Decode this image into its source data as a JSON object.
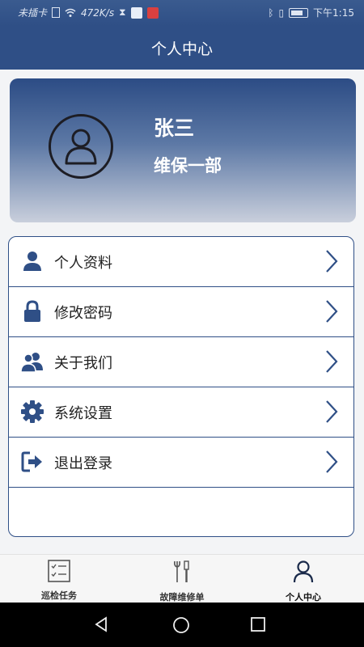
{
  "status_bar": {
    "carrier": "未插卡",
    "speed": "472K/s",
    "time": "下午1:15"
  },
  "header": {
    "title": "个人中心"
  },
  "profile": {
    "name": "张三",
    "department": "维保一部"
  },
  "menu": {
    "items": [
      {
        "label": "个人资料",
        "icon": "user-icon"
      },
      {
        "label": "修改密码",
        "icon": "lock-icon"
      },
      {
        "label": "关于我们",
        "icon": "users-icon"
      },
      {
        "label": "系统设置",
        "icon": "gear-icon"
      },
      {
        "label": "退出登录",
        "icon": "logout-icon"
      }
    ]
  },
  "tabs": [
    {
      "label": "巡检任务",
      "icon": "checklist-icon"
    },
    {
      "label": "故障维修单",
      "icon": "tools-icon"
    },
    {
      "label": "个人中心",
      "icon": "person-icon",
      "active": true
    }
  ],
  "colors": {
    "primary": "#2f4f86",
    "menu_border": "#2f4f86"
  }
}
